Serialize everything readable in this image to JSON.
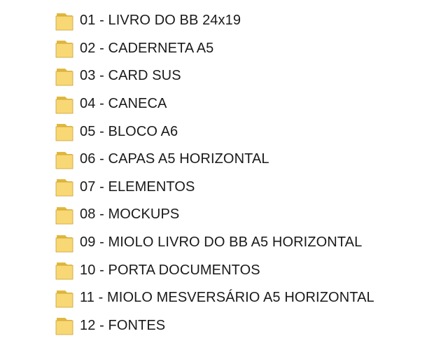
{
  "folders": [
    {
      "name": "01 - LIVRO DO BB 24x19",
      "icon": "folder-icon"
    },
    {
      "name": "02 - CADERNETA A5",
      "icon": "folder-icon"
    },
    {
      "name": "03 - CARD SUS",
      "icon": "folder-icon"
    },
    {
      "name": "04 - CANECA",
      "icon": "folder-icon"
    },
    {
      "name": "05 - BLOCO A6",
      "icon": "folder-icon"
    },
    {
      "name": "06 - CAPAS A5 HORIZONTAL",
      "icon": "folder-icon"
    },
    {
      "name": "07 - ELEMENTOS",
      "icon": "folder-icon"
    },
    {
      "name": "08 - MOCKUPS",
      "icon": "folder-icon"
    },
    {
      "name": "09 - MIOLO LIVRO DO BB A5 HORIZONTAL",
      "icon": "folder-icon"
    },
    {
      "name": "10 - PORTA DOCUMENTOS",
      "icon": "folder-icon"
    },
    {
      "name": "11 - MIOLO MESVERSÁRIO A5 HORIZONTAL",
      "icon": "folder-icon"
    },
    {
      "name": "12 - FONTES",
      "icon": "folder-icon"
    }
  ],
  "colors": {
    "folder_back": "#e0b83c",
    "folder_front": "#f8d775",
    "folder_edge": "#c9a030",
    "text": "#1a1a1a"
  }
}
